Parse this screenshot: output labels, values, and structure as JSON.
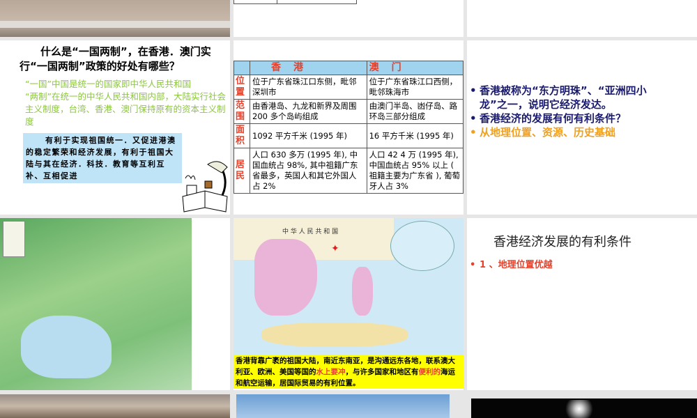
{
  "slides": [
    {
      "id": "s4",
      "question": "什么是“一国两制”，在香港．澳门实行“一国两制”政策的好处有哪些？",
      "green_text": "“一国”中国是统一的国家即中华人民共和国\n“两制”在统一的中华人民共和国内部，大陆实行社会主义制度，台湾、香港、澳门保持原有的资本主义制度",
      "blue_box": "有利于实现祖国统一．又促进港澳的稳定繁荣和经济发展，有利于祖国大陆与其在经济．科技．教育等互利互补、互相促进"
    },
    {
      "id": "s5",
      "table": {
        "headers": [
          "",
          "香港",
          "澳门"
        ],
        "rows": [
          {
            "label": "位置",
            "hk": "位于广东省珠江口东侧，毗邻深圳市",
            "mo": "位于广东省珠江口西侧，毗邻珠海市"
          },
          {
            "label": "范围",
            "hk": "由香港岛、九龙和新界及周围 200 多个岛屿组成",
            "mo": "由澳门半岛、凼仔岛、路环岛三部分组成"
          },
          {
            "label": "面积",
            "hk": "1092 平方千米 (1995 年)",
            "mo": "16 平方千米 (1995 年)"
          },
          {
            "label": "居民",
            "hk": "人口 630 多万 (1995 年), 中国血统占 98%, 其中祖籍广东省最多，英国人和其它外国人占 2%",
            "mo": "人口 42 4 万 (1995 年), 中国血统占 95% 以上 ( 祖籍主要为广东省 ), 葡萄牙人占 3%"
          }
        ]
      }
    },
    {
      "id": "s6",
      "bullets": [
        "香港被称为“东方明珠”、“亚洲四小龙”之一，说明它经济发达。",
        "香港经济的发展有何有利条件？",
        "从地理位置、资源、历史基础"
      ]
    },
    {
      "id": "s8",
      "map_label": "中 华 人 民 共 和 国",
      "caption_parts": [
        "香港背靠广袤的祖国大陆，南近东南亚，是沟通远东各地，联系澳大利亚、欧洲、美国等国的",
        "水上要冲",
        "，与许多国家和地区有",
        "便利的",
        "海运和航空运输，居国际贸易的有利位置。"
      ]
    },
    {
      "id": "s9",
      "title": "香港经济发展的有利条件",
      "bullet": "1 、地理位置优越"
    }
  ],
  "colors": {
    "green": "#8cc63f",
    "blue_box": "#bfe3f7",
    "navy": "#1a1a6e",
    "orange": "#f0a020",
    "red": "#e8402a",
    "yellow": "#ffff00"
  }
}
